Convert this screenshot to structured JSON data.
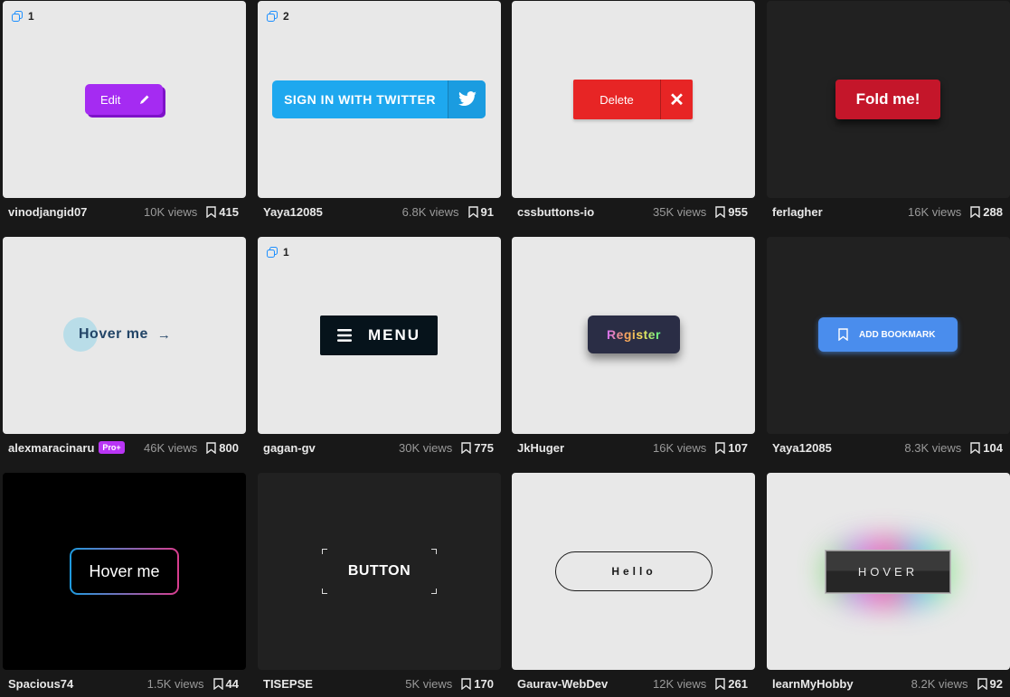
{
  "cards": [
    {
      "author": "vinodjangid07",
      "views": "10K views",
      "saves": "415",
      "badge": "1",
      "button": {
        "label": "Edit",
        "icon": "pencil-icon"
      }
    },
    {
      "author": "Yaya12085",
      "views": "6.8K views",
      "saves": "91",
      "badge": "2",
      "button": {
        "label": "SIGN IN WITH TWITTER",
        "icon": "twitter-bird-icon"
      }
    },
    {
      "author": "cssbuttons-io",
      "views": "35K views",
      "saves": "955",
      "button": {
        "label": "Delete",
        "icon": "close-x-icon",
        "icon_glyph": "✕"
      }
    },
    {
      "author": "ferlagher",
      "views": "16K views",
      "saves": "288",
      "button": {
        "label": "Fold me!"
      }
    },
    {
      "author": "alexmaracinaru",
      "pro": "Pro+",
      "views": "46K views",
      "saves": "800",
      "button": {
        "label": "Hover me",
        "arrow": "→"
      }
    },
    {
      "author": "gagan-gv",
      "views": "30K views",
      "saves": "775",
      "badge": "1",
      "button": {
        "label": "MENU",
        "icon": "hamburger-icon"
      }
    },
    {
      "author": "JkHuger",
      "views": "16K views",
      "saves": "107",
      "button": {
        "label": "Register"
      }
    },
    {
      "author": "Yaya12085",
      "views": "8.3K views",
      "saves": "104",
      "button": {
        "label": "ADD BOOKMARK",
        "icon": "bookmark-icon"
      }
    },
    {
      "author": "Spacious74",
      "views": "1.5K views",
      "saves": "44",
      "button": {
        "label": "Hover me"
      }
    },
    {
      "author": "TISEPSE",
      "views": "5K views",
      "saves": "170",
      "button": {
        "label": "BUTTON"
      }
    },
    {
      "author": "Gaurav-WebDev",
      "views": "12K views",
      "saves": "261",
      "button": {
        "label": "Hello"
      }
    },
    {
      "author": "learnMyHobby",
      "views": "8.2K views",
      "saves": "92",
      "button": {
        "label": "HOVER"
      }
    }
  ],
  "colors": {
    "page_bg": "#181818",
    "pro_badge": "#b935f5",
    "badge_icon": "#1e90ff"
  }
}
